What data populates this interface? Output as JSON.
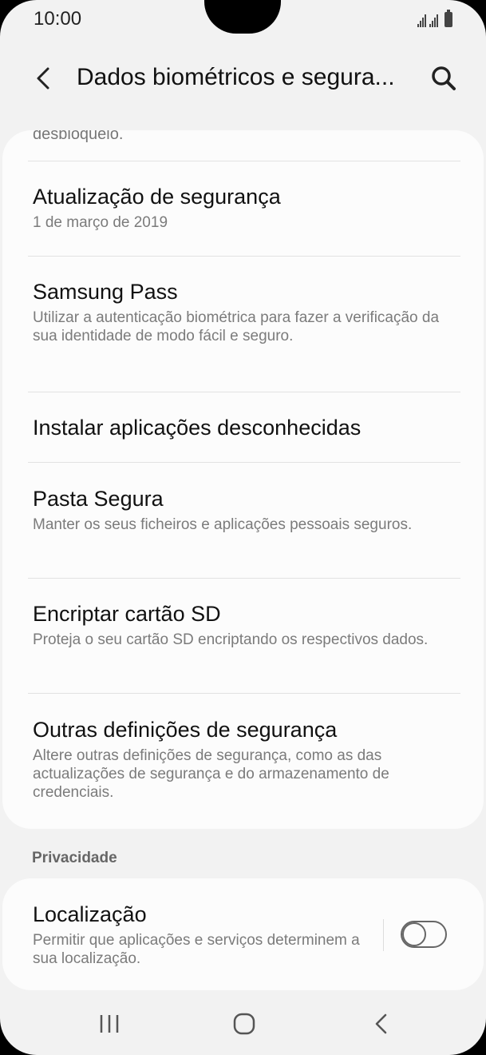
{
  "status_bar": {
    "time": "10:00"
  },
  "header": {
    "title": "Dados biométricos e segura..."
  },
  "cut_off_text": "desbloqueio.",
  "items": [
    {
      "title": "Atualização de segurança",
      "subtitle": "1 de março de 2019"
    },
    {
      "title": "Samsung Pass",
      "subtitle": "Utilizar a autenticação biométrica para fazer a verificação da sua identidade de modo fácil e seguro."
    },
    {
      "title": "Instalar aplicações desconhecidas",
      "subtitle": ""
    },
    {
      "title": "Pasta Segura",
      "subtitle": "Manter os seus ficheiros e aplicações pessoais seguros."
    },
    {
      "title": "Encriptar cartão SD",
      "subtitle": "Proteja o seu cartão SD encriptando os respectivos dados."
    },
    {
      "title": "Outras definições de segurança",
      "subtitle": "Altere outras definições de segurança, como as das actualizações de segurança e do armazenamento de credenciais."
    }
  ],
  "privacy": {
    "section_label": "Privacidade",
    "location_title": "Localização",
    "location_subtitle": "Permitir que aplicações e serviços determinem a sua localização.",
    "location_enabled": false
  },
  "colors": {
    "background": "#f2f2f2",
    "card": "#fcfcfc",
    "text_primary": "#111111",
    "text_secondary": "#7b7b7b"
  }
}
